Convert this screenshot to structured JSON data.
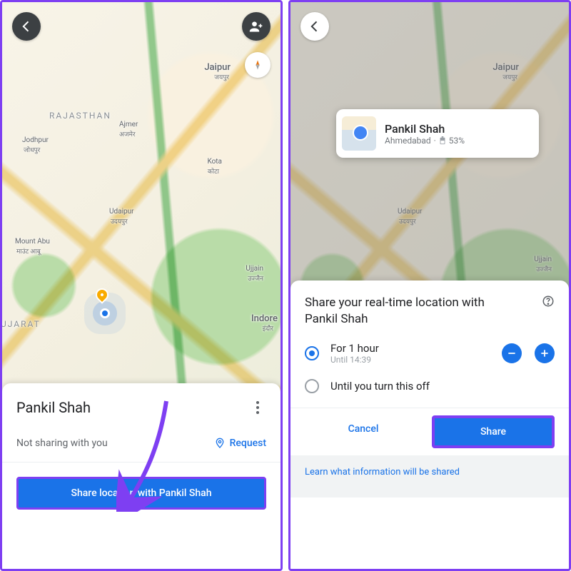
{
  "left": {
    "map_labels": {
      "jaipur_en": "Jaipur",
      "jaipur_hi": "जयपुर",
      "rajasthan": "RAJASTHAN",
      "jodhpur_en": "Jodhpur",
      "jodhpur_hi": "जोधपुर",
      "ajmer_en": "Ajmer",
      "ajmer_hi": "अजमेर",
      "kota_en": "Kota",
      "kota_hi": "कोटा",
      "udaipur_en": "Udaipur",
      "udaipur_hi": "उदयपुर",
      "mountabu_en": "Mount Abu",
      "mountabu_hi": "माउंट आबू",
      "ujjain_en": "Ujjain",
      "ujjain_hi": "उज्जैन",
      "indore_en": "Indore",
      "indore_hi": "इंदौर",
      "ujarat": "UJARAT"
    },
    "contact_name": "Pankil Shah",
    "not_sharing": "Not sharing with you",
    "request_label": "Request",
    "share_button": "Share location with Pankil Shah"
  },
  "right": {
    "map_labels": {
      "jaipur_en": "Jaipur",
      "jaipur_hi": "जयपुर",
      "udaipur_en": "Udaipur",
      "udaipur_hi": "उदयपुर",
      "ujjain_en": "Ujjain",
      "ujjain_hi": "उज्जैन"
    },
    "card": {
      "name": "Pankil Shah",
      "city": "Ahmedabad",
      "battery": "53%"
    },
    "sheet": {
      "title": "Share your real-time location with Pankil Shah",
      "opt1_label": "For 1 hour",
      "opt1_sub": "Until 14:39",
      "opt2_label": "Until you turn this off",
      "cancel": "Cancel",
      "share": "Share",
      "footer": "Learn what information will be shared"
    }
  }
}
